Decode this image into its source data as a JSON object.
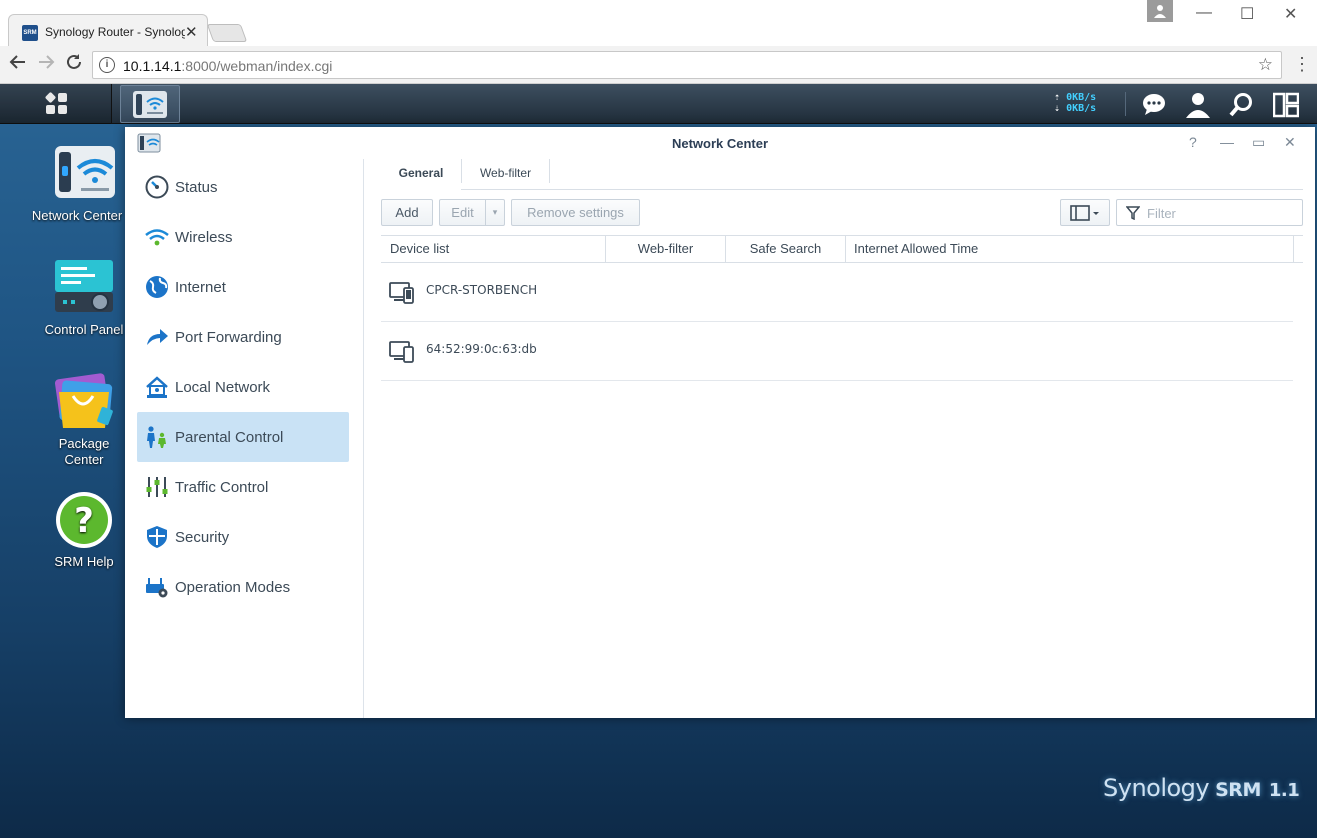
{
  "browser": {
    "tab_title": "Synology Router - Synology",
    "favicon_text": "SRM",
    "url_host": "10.1.14.1",
    "url_rest": ":8000/webman/index.cgi",
    "icons": {
      "close": "close-icon",
      "back": "back-arrow-icon",
      "forward": "forward-arrow-icon",
      "reload": "reload-icon",
      "info": "info-icon",
      "star": "bookmark-star-icon",
      "menu": "kebab-menu-icon"
    }
  },
  "taskbar": {
    "upload_speed": "0KB/s",
    "download_speed": "0KB/s",
    "accent": "#43d0ff"
  },
  "desktop": {
    "icons": [
      {
        "label": "Network Center"
      },
      {
        "label": "Control Panel"
      },
      {
        "label": "Package Center"
      },
      {
        "label": "SRM Help"
      }
    ]
  },
  "window": {
    "title": "Network Center",
    "sidebar": [
      {
        "label": "Status",
        "icon": "gauge-icon"
      },
      {
        "label": "Wireless",
        "icon": "wifi-icon"
      },
      {
        "label": "Internet",
        "icon": "globe-icon"
      },
      {
        "label": "Port Forwarding",
        "icon": "forward-arrow-icon"
      },
      {
        "label": "Local Network",
        "icon": "house-icon"
      },
      {
        "label": "Parental Control",
        "icon": "family-icon",
        "active": true
      },
      {
        "label": "Traffic Control",
        "icon": "sliders-icon"
      },
      {
        "label": "Security",
        "icon": "shield-icon"
      },
      {
        "label": "Operation Modes",
        "icon": "router-gear-icon"
      }
    ],
    "tabs": [
      {
        "label": "General",
        "active": true
      },
      {
        "label": "Web-filter"
      }
    ],
    "toolbar": {
      "add": "Add",
      "edit": "Edit",
      "remove": "Remove settings",
      "filter_placeholder": "Filter"
    },
    "table": {
      "headers": [
        "Device list",
        "Web-filter",
        "Safe Search",
        "Internet Allowed Time"
      ],
      "rows": [
        {
          "device": "CPCR-STORBENCH"
        },
        {
          "device": "64:52:99:0c:63:db"
        }
      ]
    }
  },
  "brand": {
    "name": "Synology",
    "product": "SRM",
    "version": "1.1"
  }
}
